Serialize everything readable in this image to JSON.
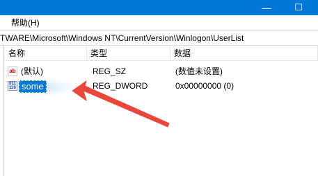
{
  "window": {
    "accent_color": "#0078d7",
    "title_buttons": [
      "minimize-icon",
      "maximize-icon"
    ]
  },
  "menu": {
    "items": [
      "帮助(H)"
    ]
  },
  "address": {
    "path": "TWARE\\Microsoft\\Windows NT\\CurrentVersion\\Winlogon\\UserList"
  },
  "table": {
    "headers": [
      "名称",
      "类型",
      "数据"
    ],
    "rows": [
      {
        "icon": "string-value-icon",
        "name": "(默认)",
        "type": "REG_SZ",
        "data": "(数值未设置)"
      },
      {
        "icon": "binary-value-icon",
        "name": "some",
        "type": "REG_DWORD",
        "data": "0x00000000 (0)",
        "selected": true,
        "editing": true
      }
    ]
  },
  "annotation": {
    "arrow_color": "#e8473b"
  }
}
